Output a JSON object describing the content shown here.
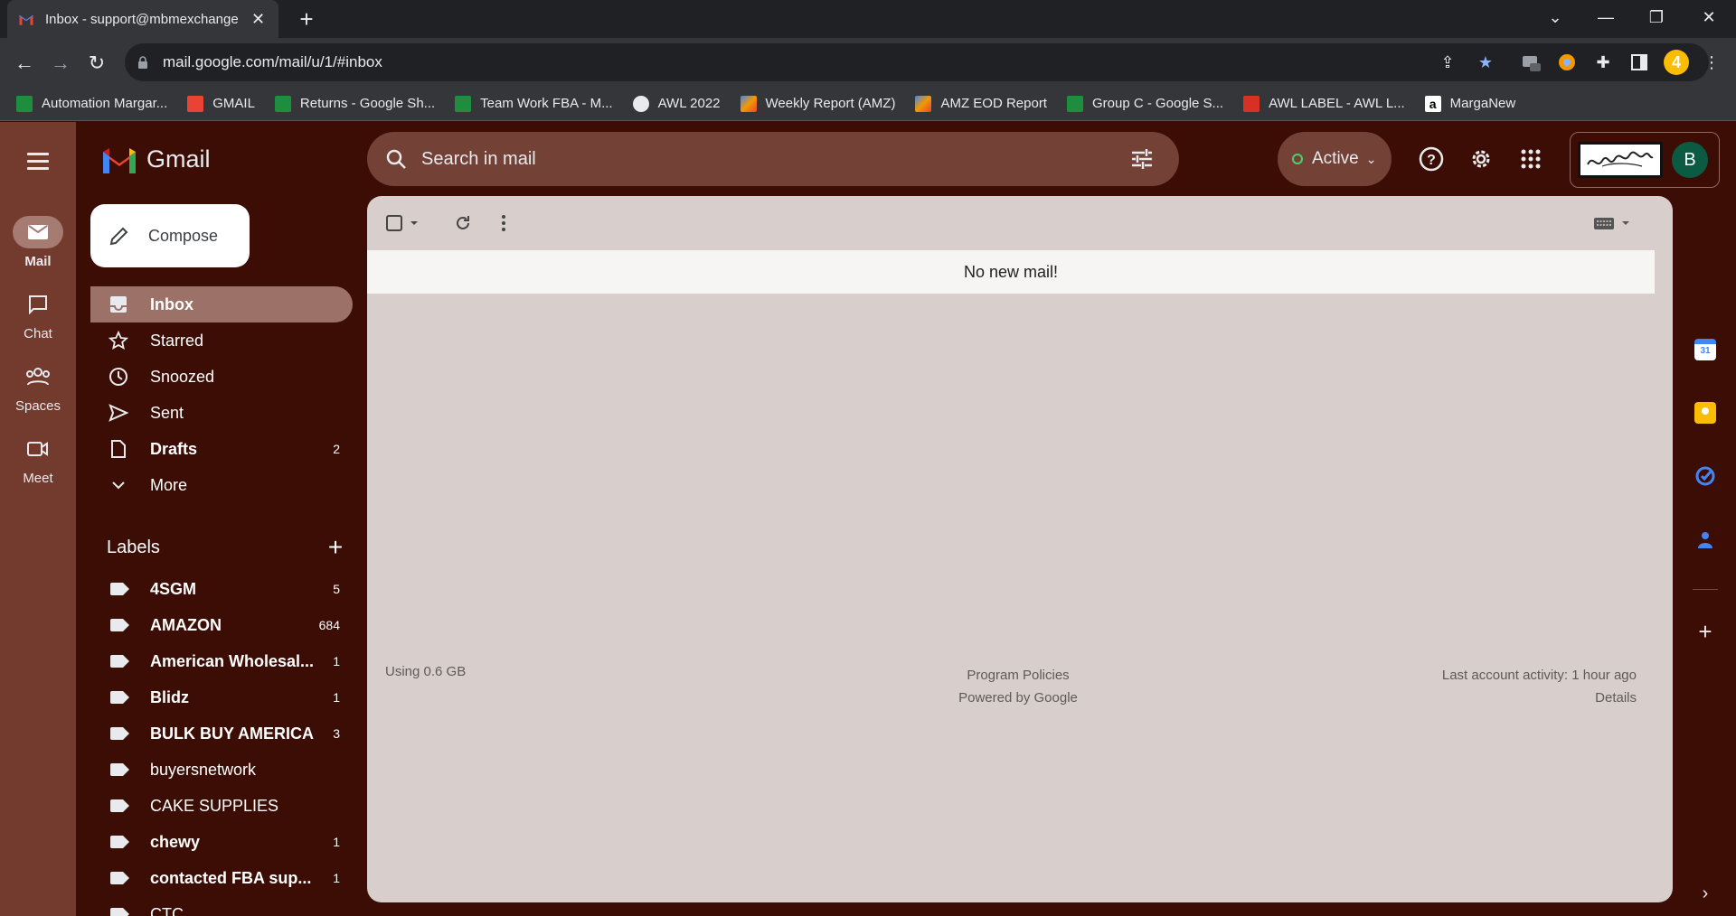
{
  "browser": {
    "tab_title": "Inbox - support@mbmexchange",
    "url": "mail.google.com/mail/u/1/#inbox",
    "profile_badge": "4",
    "bookmarks": [
      {
        "label": "Automation Margar...",
        "icon": "sheets-icon",
        "color": "#1e8e3e"
      },
      {
        "label": "GMAIL",
        "icon": "gmail-icon",
        "color": "#ea4335"
      },
      {
        "label": "Returns - Google Sh...",
        "icon": "sheets-icon",
        "color": "#1e8e3e"
      },
      {
        "label": "Team Work FBA - M...",
        "icon": "sheets-icon",
        "color": "#1e8e3e"
      },
      {
        "label": "AWL 2022",
        "icon": "globe-icon",
        "color": "#e8eaed"
      },
      {
        "label": "Weekly Report (AMZ)",
        "icon": "datastudio-icon",
        "color": "#f29900"
      },
      {
        "label": "AMZ EOD Report",
        "icon": "datastudio-icon",
        "color": "#f29900"
      },
      {
        "label": "Group C - Google S...",
        "icon": "sheets-icon",
        "color": "#1e8e3e"
      },
      {
        "label": "AWL LABEL - AWL L...",
        "icon": "awl-icon",
        "color": "#d93025"
      },
      {
        "label": "MargaNew",
        "icon": "amazon-icon",
        "color": "#222222"
      }
    ]
  },
  "gmail": {
    "product_name": "Gmail",
    "rail": [
      {
        "label": "Mail",
        "icon": "mail-icon",
        "active": true
      },
      {
        "label": "Chat",
        "icon": "chat-icon",
        "active": false
      },
      {
        "label": "Spaces",
        "icon": "spaces-icon",
        "active": false
      },
      {
        "label": "Meet",
        "icon": "meet-icon",
        "active": false
      }
    ],
    "search_placeholder": "Search in mail",
    "status": "Active",
    "avatar_initial": "B",
    "compose_label": "Compose",
    "nav": [
      {
        "label": "Inbox",
        "icon": "inbox-icon",
        "count": "",
        "active": true
      },
      {
        "label": "Starred",
        "icon": "star-icon",
        "count": ""
      },
      {
        "label": "Snoozed",
        "icon": "clock-icon",
        "count": ""
      },
      {
        "label": "Sent",
        "icon": "send-icon",
        "count": ""
      },
      {
        "label": "Drafts",
        "icon": "draft-icon",
        "count": "2",
        "bold": true
      },
      {
        "label": "More",
        "icon": "chevron-down-icon",
        "count": ""
      }
    ],
    "labels_heading": "Labels",
    "labels": [
      {
        "name": "4SGM",
        "count": "5",
        "bold": true
      },
      {
        "name": "AMAZON",
        "count": "684",
        "bold": true
      },
      {
        "name": "American Wholesal...",
        "count": "1",
        "bold": true
      },
      {
        "name": "Blidz",
        "count": "1",
        "bold": true
      },
      {
        "name": "BULK BUY AMERICA",
        "count": "3",
        "bold": true
      },
      {
        "name": "buyersnetwork",
        "count": "",
        "bold": false
      },
      {
        "name": "CAKE SUPPLIES",
        "count": "",
        "bold": false
      },
      {
        "name": "chewy",
        "count": "1",
        "bold": true
      },
      {
        "name": "contacted FBA sup...",
        "count": "1",
        "bold": true
      },
      {
        "name": "CTC",
        "count": "",
        "bold": false
      }
    ],
    "empty_message": "No new mail!",
    "footer": {
      "storage": "Using 0.6 GB",
      "policies": "Program Policies",
      "powered": "Powered by Google",
      "activity": "Last account activity: 1 hour ago",
      "details": "Details"
    }
  }
}
